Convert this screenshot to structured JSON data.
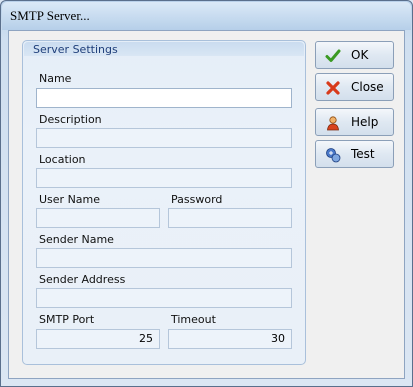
{
  "window": {
    "title": "SMTP Server..."
  },
  "group": {
    "title": "Server Settings",
    "fields": {
      "name": {
        "label": "Name",
        "value": ""
      },
      "description": {
        "label": "Description",
        "value": ""
      },
      "location": {
        "label": "Location",
        "value": ""
      },
      "user_name": {
        "label": "User Name",
        "value": ""
      },
      "password": {
        "label": "Password",
        "value": ""
      },
      "sender_name": {
        "label": "Sender Name",
        "value": ""
      },
      "sender_address": {
        "label": "Sender Address",
        "value": ""
      },
      "smtp_port": {
        "label": "SMTP Port",
        "value": "25"
      },
      "timeout": {
        "label": "Timeout",
        "value": "30"
      }
    }
  },
  "buttons": {
    "ok": {
      "label": "OK",
      "icon": "checkmark-icon"
    },
    "close": {
      "label": "Close",
      "icon": "close-x-icon"
    },
    "help": {
      "label": "Help",
      "icon": "help-person-icon"
    },
    "test": {
      "label": "Test",
      "icon": "test-network-icon"
    }
  },
  "colors": {
    "accent": "#1e3e7a",
    "ok_green": "#3a9a22",
    "close_red": "#d83a1a"
  }
}
